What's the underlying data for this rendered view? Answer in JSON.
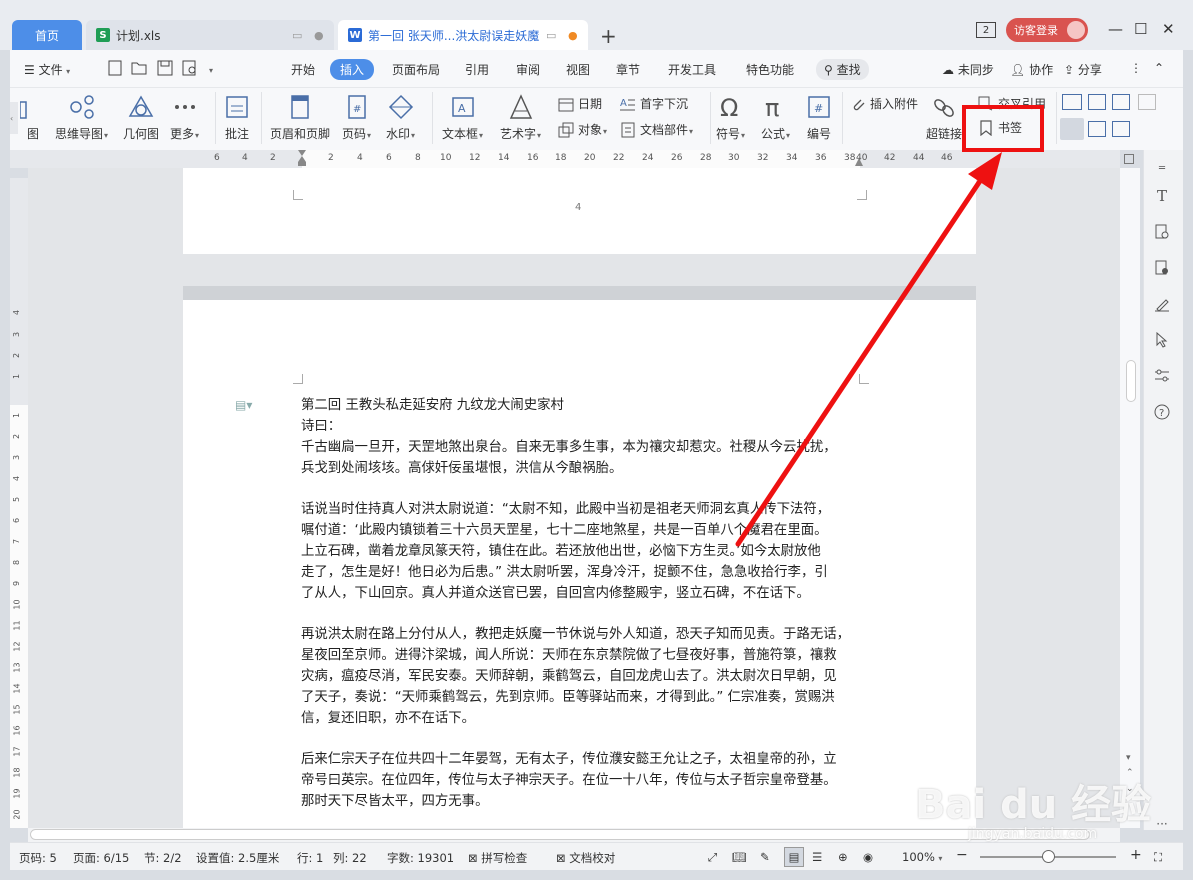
{
  "tabs": {
    "home": "首页",
    "xls": "计划.xls",
    "doc": "第一回 张天师...洪太尉误走妖魔",
    "new": "+"
  },
  "window": {
    "badge": "2",
    "login": "访客登录",
    "min": "—",
    "max": "☐",
    "close": "✕"
  },
  "menu": {
    "file": "文件",
    "items": [
      "开始",
      "插入",
      "页面布局",
      "引用",
      "审阅",
      "视图",
      "章节",
      "开发工具",
      "特色功能"
    ],
    "search": "查找",
    "unsync": "未同步",
    "collab": "协作",
    "share": "分享"
  },
  "ribbon": {
    "chart_partial": "图",
    "mindmap": "思维导图",
    "geometry": "几何图",
    "more": "更多",
    "comment": "批注",
    "header_footer": "页眉和页脚",
    "page_number": "页码",
    "watermark": "水印",
    "textbox": "文本框",
    "wordart": "艺术字",
    "date": "日期",
    "object": "对象",
    "dropcap": "首字下沉",
    "docpart": "文档部件",
    "symbol": "符号",
    "formula": "公式",
    "numbering": "编号",
    "attach": "插入附件",
    "hyperlink": "超链接",
    "crossref": "交叉引用",
    "bookmark": "书签"
  },
  "ruler_ticks": [
    "6",
    "4",
    "2",
    "2",
    "4",
    "6",
    "8",
    "10",
    "12",
    "14",
    "16",
    "18",
    "20",
    "22",
    "24",
    "26",
    "28",
    "30",
    "32",
    "34",
    "36",
    "38",
    "40",
    "42",
    "44",
    "46"
  ],
  "left_ruler_ticks": [
    "4",
    "3",
    "2",
    "1",
    "1",
    "2",
    "3",
    "4",
    "5",
    "6",
    "7",
    "8",
    "9",
    "10",
    "11",
    "12",
    "13",
    "14",
    "15",
    "16",
    "17",
    "18",
    "19",
    "20"
  ],
  "document": {
    "page_number": "4",
    "lines": [
      "第二回  王教头私走延安府  九纹龙大闹史家村",
      "诗曰：",
      "千古幽扃一旦开，天罡地煞出泉台。自来无事多生事，本为禳灾却惹灾。社稷从今云扰扰，",
      "兵戈到处闹垓垓。高俅奸佞虽堪恨，洪信从今酿祸胎。",
      "",
      "话说当时住持真人对洪太尉说道：“太尉不知，此殿中当初是祖老天师洞玄真人传下法符，",
      "嘱付道：‘此殿内镇锁着三十六员天罡星，七十二座地煞星，共是一百单八个魔君在里面。",
      "上立石碑，凿着龙章凤篆天符，镇住在此。若还放他出世，必恼下方生灵。’如今太尉放他",
      "走了，怎生是好！他日必为后患。” 洪太尉听罢，浑身冷汗，捉颤不住，急急收拾行李，引",
      "了从人，下山回京。真人并道众送官已罢，自回宫内修整殿宇，竖立石碑，不在话下。",
      "",
      "再说洪太尉在路上分付从人，教把走妖魔一节休说与外人知道，恐天子知而见责。于路无话，",
      "星夜回至京师。进得汴梁城，闻人所说：天师在东京禁院做了七昼夜好事，普施符箓，禳救",
      "灾病，瘟疫尽消，军民安泰。天师辞朝，乘鹤驾云，自回龙虎山去了。洪太尉次日早朝，见",
      "了天子，奏说：“天师乘鹤驾云，先到京师。臣等驿站而来，才得到此。” 仁宗准奏，赏赐洪",
      "信，复还旧职，亦不在话下。",
      "",
      "后来仁宗天子在位共四十二年晏驾，无有太子，传位濮安懿王允让之子，太祖皇帝的孙，立",
      "帝号曰英宗。在位四年，传位与太子神宗天子。在位一十八年，传位与太子哲宗皇帝登基。",
      "那时天下尽皆太平，四方无事。"
    ]
  },
  "status": {
    "page_code": "页码: 5",
    "page": "页面: 6/15",
    "section": "节: 2/2",
    "setting": "设置值: 2.5厘米",
    "row": "行: 1",
    "col": "列: 22",
    "words": "字数: 19301",
    "spell": "拼写检查",
    "proof": "文档校对",
    "zoom": "100%",
    "zoom_minus": "−",
    "zoom_plus": "+"
  },
  "watermark": {
    "main": "Bai du 经验",
    "sub": "jingyan.baidu.com"
  },
  "colors": {
    "accent": "#4d8ee8",
    "highlight": "#ee1111",
    "login": "#d9534f"
  }
}
